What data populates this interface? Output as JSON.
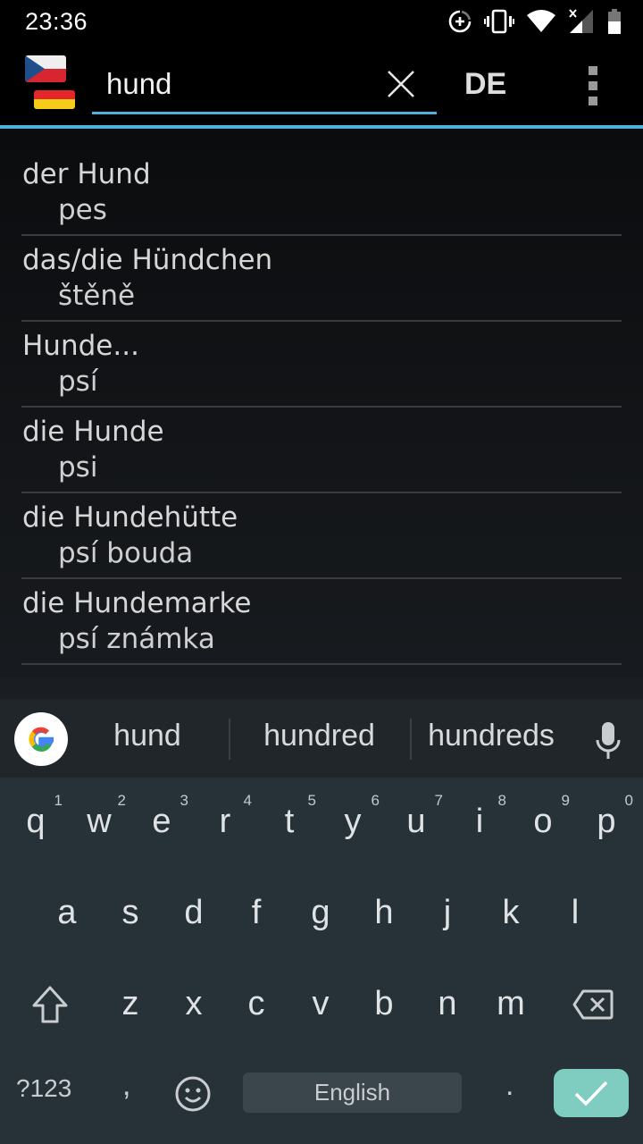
{
  "status_bar": {
    "time": "23:36",
    "icons": [
      "data-saver-icon",
      "vibrate-icon",
      "wifi-icon",
      "signal-no-data-icon",
      "battery-icon"
    ]
  },
  "toolbar": {
    "source_flag": "czech-flag",
    "target_flag": "german-flag",
    "search_value": "hund",
    "search_placeholder": "",
    "clear_icon": "close-icon",
    "language_label": "DE",
    "menu_icon": "overflow-menu-icon",
    "accent_color": "#4fb0dc"
  },
  "results": [
    {
      "term": "der Hund",
      "translation": "pes"
    },
    {
      "term": "das/die Hündchen",
      "translation": "štěně"
    },
    {
      "term": "Hunde...",
      "translation": "psí"
    },
    {
      "term": "die Hunde",
      "translation": "psi"
    },
    {
      "term": "die Hundehütte",
      "translation": "psí bouda"
    },
    {
      "term": "die Hundemarke",
      "translation": "psí známka"
    }
  ],
  "keyboard": {
    "suggestions": [
      "hund",
      "hundred",
      "hundreds"
    ],
    "row1": [
      {
        "ch": "q",
        "hint": "1"
      },
      {
        "ch": "w",
        "hint": "2"
      },
      {
        "ch": "e",
        "hint": "3"
      },
      {
        "ch": "r",
        "hint": "4"
      },
      {
        "ch": "t",
        "hint": "5"
      },
      {
        "ch": "y",
        "hint": "6"
      },
      {
        "ch": "u",
        "hint": "7"
      },
      {
        "ch": "i",
        "hint": "8"
      },
      {
        "ch": "o",
        "hint": "9"
      },
      {
        "ch": "p",
        "hint": "0"
      }
    ],
    "row2": [
      "a",
      "s",
      "d",
      "f",
      "g",
      "h",
      "j",
      "k",
      "l"
    ],
    "row3": [
      "z",
      "x",
      "c",
      "v",
      "b",
      "n",
      "m"
    ],
    "symbols_label": "?123",
    "comma_label": ",",
    "period_label": ".",
    "space_label": "English",
    "enter_color": "#7ecdc0"
  }
}
